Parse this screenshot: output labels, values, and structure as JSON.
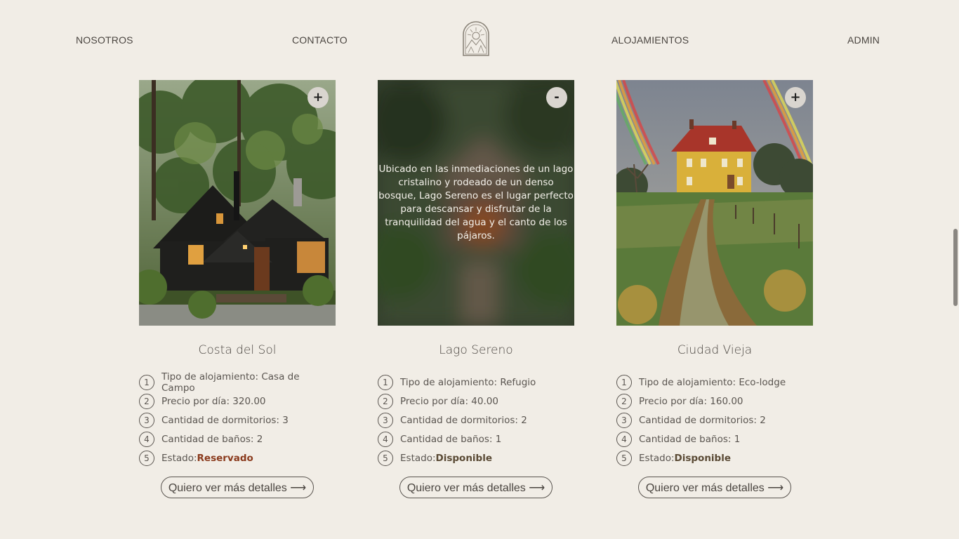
{
  "nav": {
    "items": [
      "NOSOTROS",
      "CONTACTO",
      "ALOJAMIENTOS",
      "ADMIN"
    ],
    "logo_icon": "sun-mountain-arch-logo"
  },
  "cards": [
    {
      "toggle": "+",
      "title": "Costa del Sol",
      "image_icon": "dark-cabin-forest-image",
      "features": [
        {
          "num": "1",
          "text": "Tipo de alojamiento: Casa de Campo"
        },
        {
          "num": "2",
          "text": "Precio por día: 320.00"
        },
        {
          "num": "3",
          "text": "Cantidad de dormitorios: 3"
        },
        {
          "num": "4",
          "text": "Cantidad de baños: 2"
        }
      ],
      "status": {
        "num": "5",
        "label": "Estado:",
        "value": "Reservado",
        "color": "#8a3a1c"
      },
      "button": "Quiero ver más detalles ⟶"
    },
    {
      "toggle": "-",
      "title": "Lago Sereno",
      "image_icon": "blurred-cabin-forest-image",
      "description": "Ubicado en las inmediaciones de un lago cristalino y rodeado de un denso bosque, Lago Sereno es el lugar perfecto para descansar y disfrutar de la tranquilidad del agua y el canto de los pájaros.",
      "features": [
        {
          "num": "1",
          "text": "Tipo de alojamiento: Refugio"
        },
        {
          "num": "2",
          "text": "Precio por día: 40.00"
        },
        {
          "num": "3",
          "text": "Cantidad de dormitorios: 2"
        },
        {
          "num": "4",
          "text": "Cantidad de baños: 1"
        }
      ],
      "status": {
        "num": "5",
        "label": "Estado:",
        "value": "Disponible",
        "color": "#5a4a35"
      },
      "button": "Quiero ver más detalles ⟶"
    },
    {
      "toggle": "+",
      "title": "Ciudad Vieja",
      "image_icon": "yellow-house-rainbow-image",
      "features": [
        {
          "num": "1",
          "text": "Tipo de alojamiento: Eco-lodge"
        },
        {
          "num": "2",
          "text": "Precio por día: 160.00"
        },
        {
          "num": "3",
          "text": "Cantidad de dormitorios: 2"
        },
        {
          "num": "4",
          "text": "Cantidad de baños: 1"
        }
      ],
      "status": {
        "num": "5",
        "label": "Estado:",
        "value": "Disponible",
        "color": "#5a4a35"
      },
      "button": "Quiero ver más detalles ⟶"
    }
  ],
  "colors": {
    "background": "#f1ede6",
    "text": "#4a4540",
    "reservado": "#8a3a1c",
    "disponible": "#5a4a35"
  }
}
